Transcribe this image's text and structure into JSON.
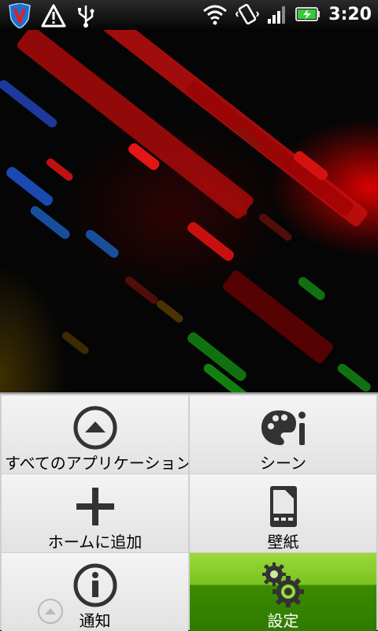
{
  "status_bar": {
    "time": "3:20",
    "left_icons": [
      "shield-v-icon",
      "warning-icon",
      "usb-icon"
    ],
    "right_icons": [
      "wifi-icon",
      "vibrate-icon",
      "signal-icon",
      "battery-charging-icon"
    ],
    "colors": {
      "battery": "#33cc33",
      "shield": "#1e6fd0"
    }
  },
  "menu": {
    "items": [
      {
        "label": "すべてのアプリケーション",
        "icon": "chevron-up-circle-icon"
      },
      {
        "label": "シーン",
        "icon": "palette-brush-icon"
      },
      {
        "label": "ホームに追加",
        "icon": "plus-icon"
      },
      {
        "label": "壁紙",
        "icon": "wallpaper-phone-icon"
      },
      {
        "label": "通知",
        "icon": "info-icon"
      },
      {
        "label": "設定",
        "icon": "gears-icon"
      }
    ],
    "selected": "設定",
    "colors": {
      "selected_top": "#9ad93a",
      "selected_bottom": "#2f7a00"
    }
  }
}
